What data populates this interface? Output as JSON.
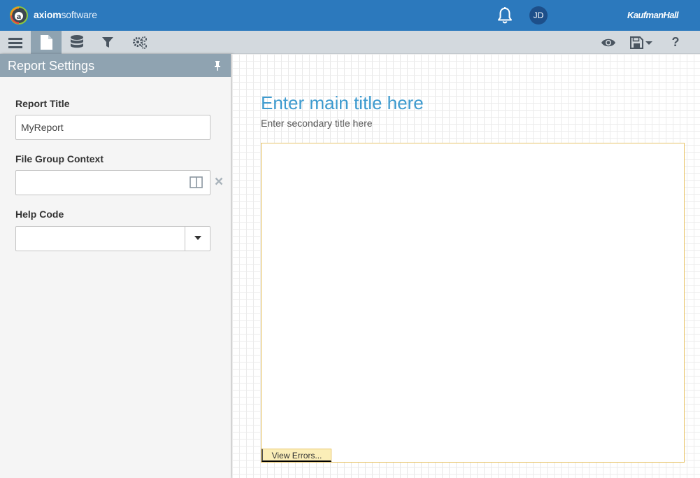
{
  "header": {
    "logo_prefix": "axiom",
    "logo_suffix": "software",
    "notification_icon": "bell-icon",
    "user_initials": "JD",
    "brand": "KaufmanHall"
  },
  "toolbar": {
    "left_icons": [
      "menu-icon",
      "document-icon",
      "database-icon",
      "filter-icon",
      "gears-icon"
    ],
    "right_icons": [
      "eye-icon",
      "save-icon",
      "help-icon"
    ],
    "help_label": "?"
  },
  "panel": {
    "title": "Report Settings",
    "fields": {
      "report_title": {
        "label": "Report Title",
        "value": "MyReport"
      },
      "file_group_context": {
        "label": "File Group Context",
        "value": ""
      },
      "help_code": {
        "label": "Help Code",
        "value": ""
      }
    }
  },
  "canvas": {
    "main_title": "Enter main title here",
    "secondary_title": "Enter secondary title here",
    "view_errors": "View Errors..."
  },
  "colors": {
    "header_bg": "#2c79bd",
    "toolbar_bg": "#d3d9de",
    "panel_header_bg": "#8fa3b1",
    "title_blue": "#3f9bcf",
    "error_bar": "#fbeeb8",
    "report_border": "#e8c56a"
  }
}
